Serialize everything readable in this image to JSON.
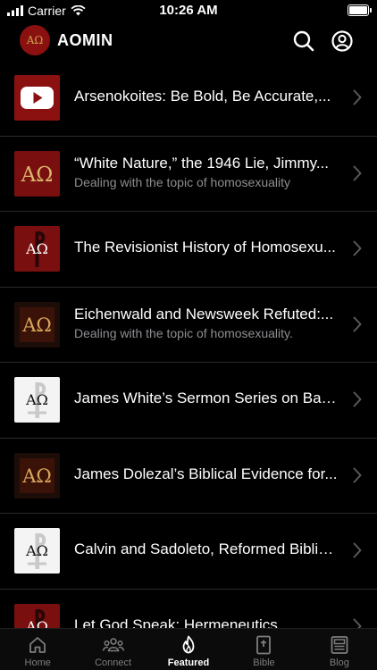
{
  "status_bar": {
    "carrier": "Carrier",
    "time": "10:26 AM",
    "battery_level": 1.0
  },
  "header": {
    "title": "AOMIN",
    "logo_text": "AΩ"
  },
  "items": [
    {
      "title": "Arsenokoites: Be Bold, Be Accurate,...",
      "subtitle": "",
      "thumb": "youtube"
    },
    {
      "title": "“White Nature,” the 1946 Lie, Jimmy...",
      "subtitle": "Dealing with the topic of homosexuality",
      "thumb": "red"
    },
    {
      "title": "The Revisionist History of Homosexu...",
      "subtitle": "",
      "thumb": "red-theology"
    },
    {
      "title": "Eichenwald and Newsweek Refuted:...",
      "subtitle": "Dealing with the topic of homosexuality.",
      "thumb": "dark"
    },
    {
      "title": "James White’s Sermon Series on Bap...",
      "subtitle": "",
      "thumb": "white-theology"
    },
    {
      "title": "James Dolezal’s Biblical Evidence for...",
      "subtitle": "",
      "thumb": "dark"
    },
    {
      "title": "Calvin and Sadoleto, Reformed Biblici...",
      "subtitle": "",
      "thumb": "white-theology"
    },
    {
      "title": "Let God Speak: Hermeneutics",
      "subtitle": "",
      "thumb": "red-theology"
    }
  ],
  "tabs": [
    {
      "label": "Home",
      "icon": "home-icon",
      "active": false
    },
    {
      "label": "Connect",
      "icon": "people-icon",
      "active": false
    },
    {
      "label": "Featured",
      "icon": "flame-icon",
      "active": true
    },
    {
      "label": "Bible",
      "icon": "bible-icon",
      "active": false
    },
    {
      "label": "Blog",
      "icon": "blog-icon",
      "active": false
    }
  ],
  "colors": {
    "background": "#000000",
    "brand_red": "#8b1111",
    "gold": "#c9a24b",
    "secondary_text": "#8e8e93"
  }
}
